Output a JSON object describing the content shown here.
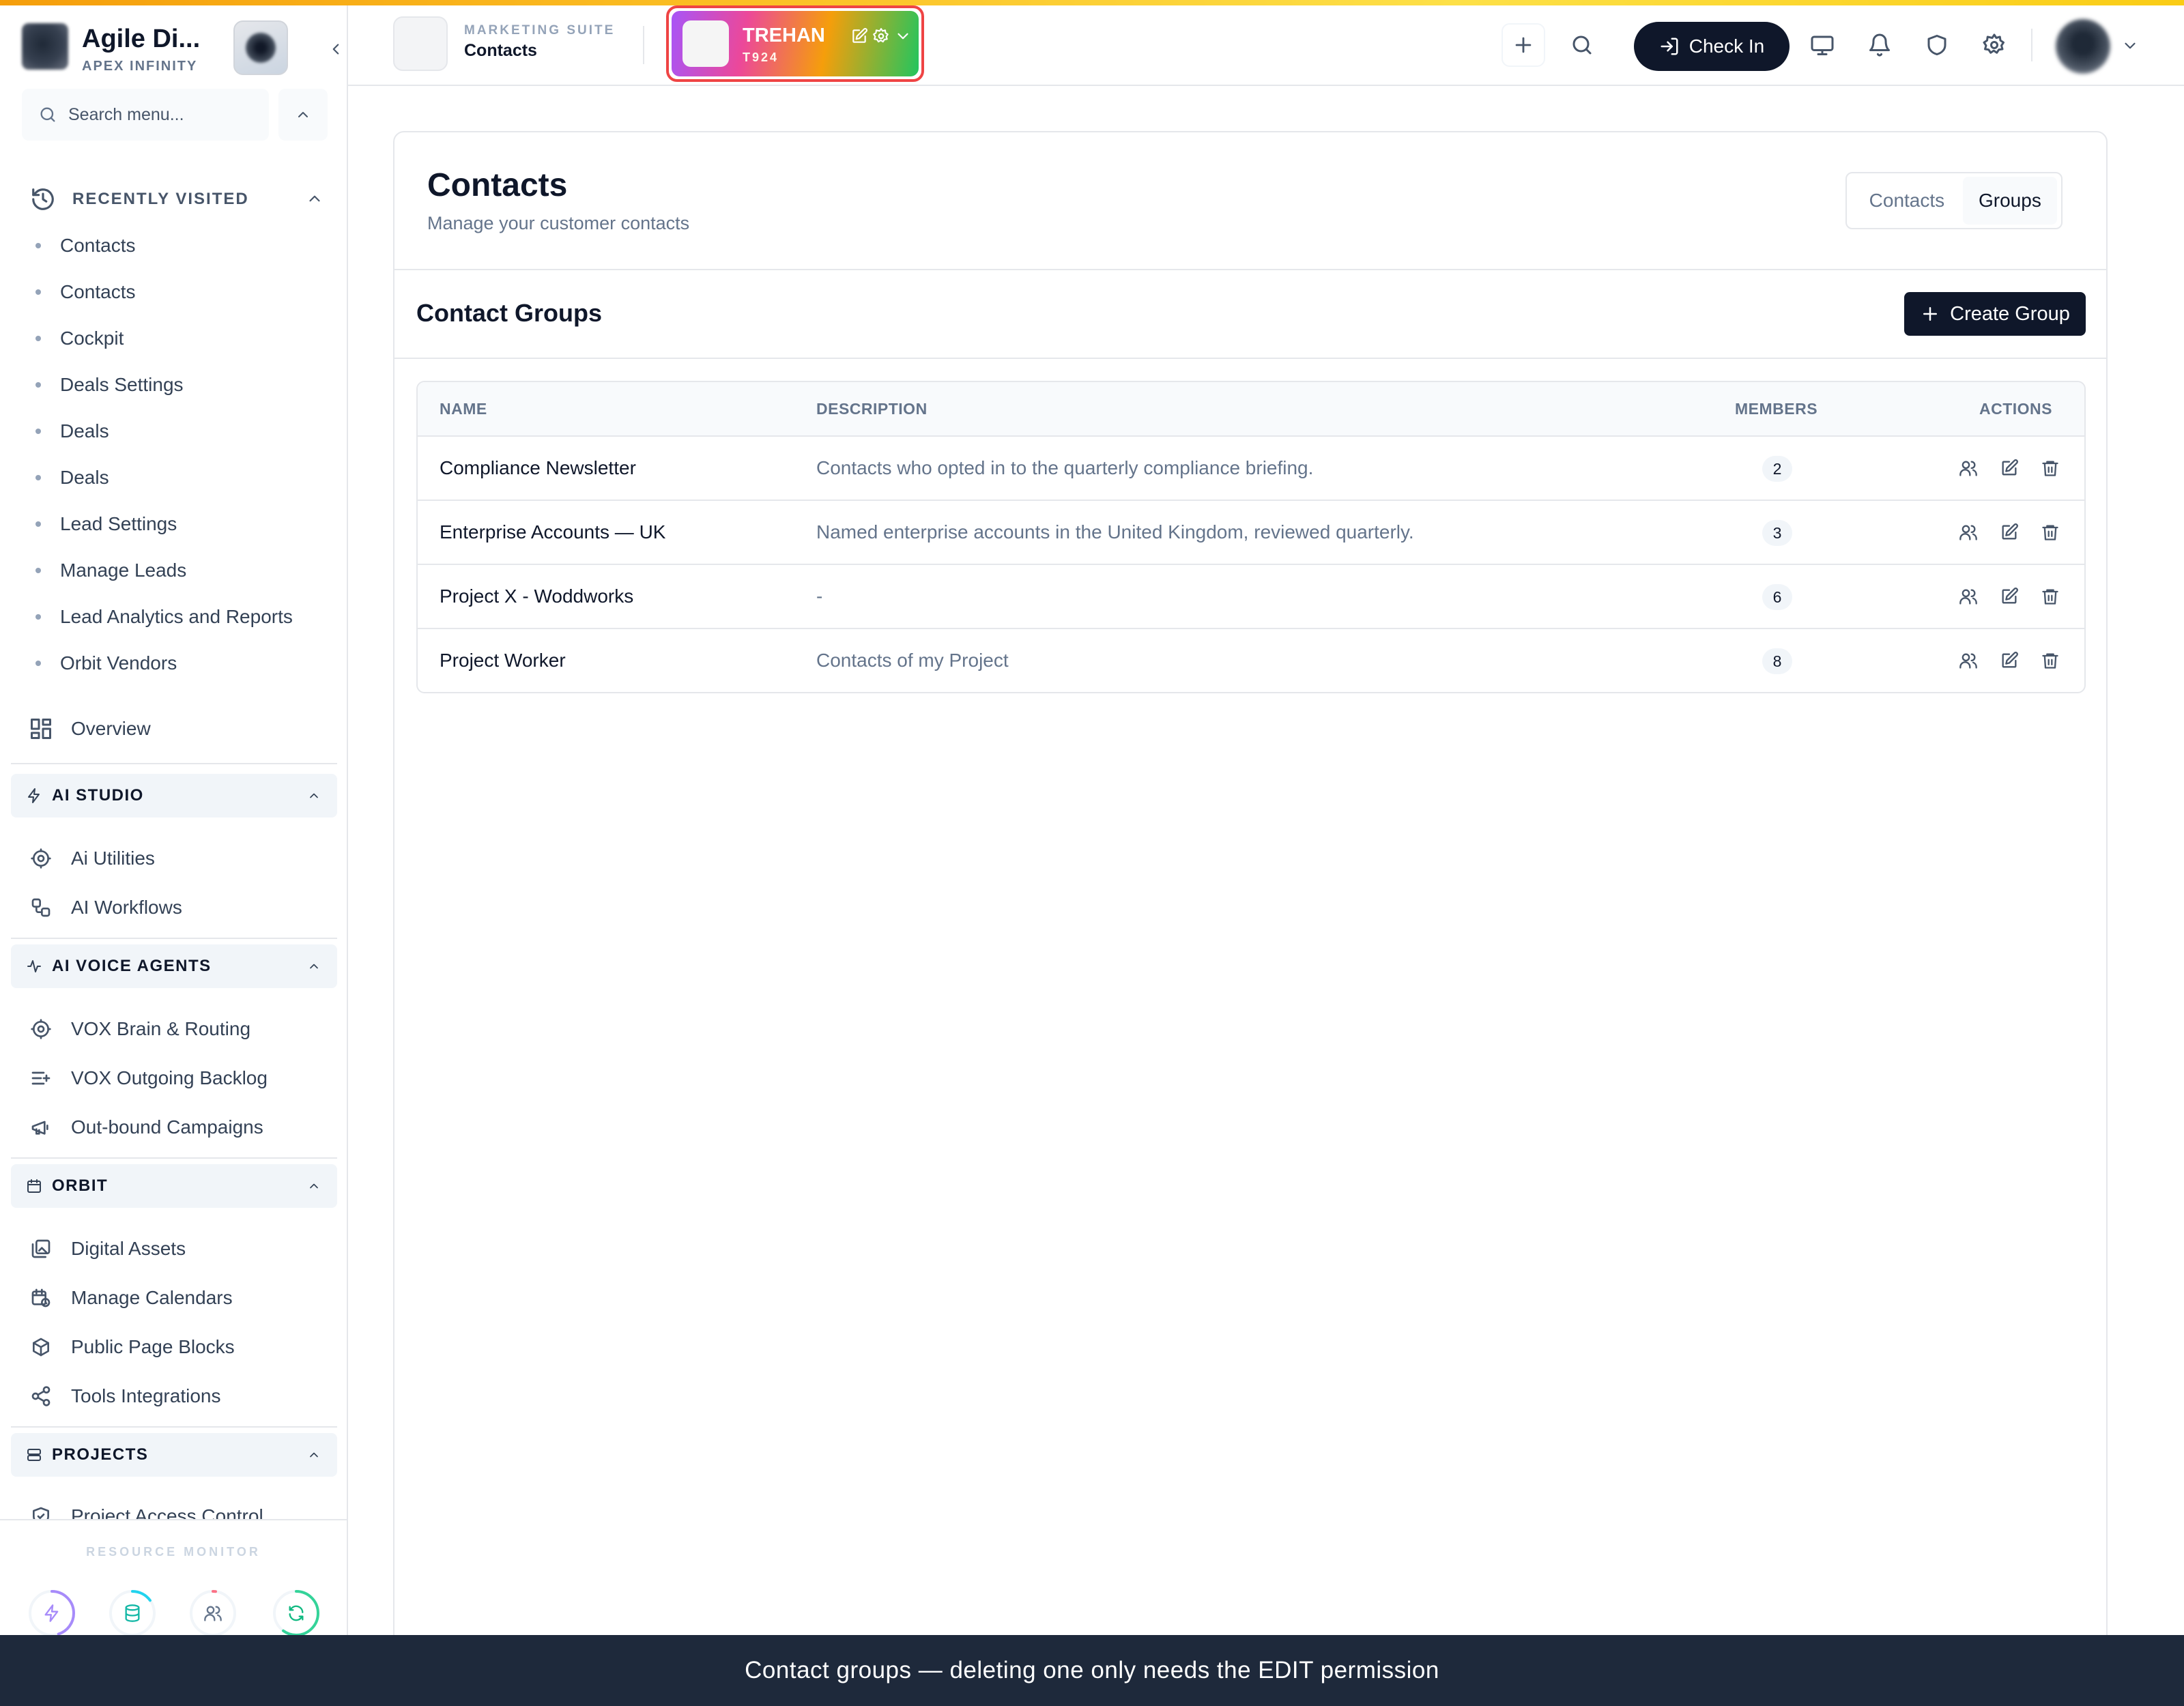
{
  "colors": {
    "accent_strip": "#fbbf24",
    "primary_dark": "#0f172a",
    "tenant_outline": "#ef4444",
    "tenant_gradient": [
      "#a855f7",
      "#ec4899",
      "#f59e0b",
      "#22c55e"
    ],
    "caption_bg": "#1e293b"
  },
  "sidebar": {
    "brand_name": "Agile Di...",
    "brand_sub": "APEX INFINITY",
    "collapse_icon": "chevron-left-icon",
    "search_placeholder": "Search menu...",
    "recent": {
      "label": "RECENTLY VISITED",
      "items": [
        "Contacts",
        "Contacts",
        "Cockpit",
        "Deals Settings",
        "Deals",
        "Deals",
        "Lead Settings",
        "Manage Leads",
        "Lead Analytics and Reports",
        "Orbit Vendors"
      ]
    },
    "overview": {
      "label": "Overview",
      "icon": "layout-dashboard-icon"
    },
    "sections": [
      {
        "title": "AI STUDIO",
        "icon": "zap-icon",
        "items": [
          {
            "label": "Ai Utilities",
            "icon": "cog-icon"
          },
          {
            "label": "AI Workflows",
            "icon": "workflow-icon"
          }
        ]
      },
      {
        "title": "AI VOICE AGENTS",
        "icon": "activity-icon",
        "items": [
          {
            "label": "VOX Brain & Routing",
            "icon": "cog-icon"
          },
          {
            "label": "VOX Outgoing Backlog",
            "icon": "list-plus-icon"
          },
          {
            "label": "Out-bound Campaigns",
            "icon": "megaphone-icon"
          }
        ]
      },
      {
        "title": "ORBIT",
        "icon": "calendar-icon",
        "items": [
          {
            "label": "Digital Assets",
            "icon": "images-icon"
          },
          {
            "label": "Manage Calendars",
            "icon": "calendar-clock-icon"
          },
          {
            "label": "Public Page Blocks",
            "icon": "box-icon"
          },
          {
            "label": "Tools Integrations",
            "icon": "share-icon"
          }
        ]
      },
      {
        "title": "PROJECTS",
        "icon": "server-icon",
        "items": [
          {
            "label": "Project Access Control",
            "icon": "shield-check-icon"
          }
        ]
      }
    ],
    "resource_monitor": {
      "label": "RESOURCE MONITOR",
      "gauges": [
        {
          "icon": "zap-icon",
          "level": 0.45,
          "color": "#a78bfa"
        },
        {
          "icon": "database-icon",
          "level": 0.15,
          "color": "#22d3ee"
        },
        {
          "icon": "users-icon",
          "level": 0.02,
          "color": "#fb7185"
        },
        {
          "icon": "refresh-icon",
          "level": 0.6,
          "color": "#34d399"
        }
      ]
    }
  },
  "topbar": {
    "suite_label": "MARKETING SUITE",
    "suite_page": "Contacts",
    "tenant": {
      "name": "TREHAN",
      "code": "T924"
    },
    "check_in_label": "Check In"
  },
  "main": {
    "title": "Contacts",
    "subtitle": "Manage your customer contacts",
    "tabs": [
      "Contacts",
      "Groups"
    ],
    "active_tab": "Groups",
    "groups_title": "Contact Groups",
    "create_label": "Create Group",
    "table": {
      "columns": [
        "NAME",
        "DESCRIPTION",
        "MEMBERS",
        "ACTIONS"
      ],
      "rows": [
        {
          "name": "Compliance Newsletter",
          "description": "Contacts who opted in to the quarterly compliance briefing.",
          "members": "2"
        },
        {
          "name": "Enterprise Accounts — UK",
          "description": "Named enterprise accounts in the United Kingdom, reviewed quarterly.",
          "members": "3"
        },
        {
          "name": "Project X - Woddworks",
          "description": "-",
          "members": "6"
        },
        {
          "name": "Project Worker",
          "description": "Contacts of my Project",
          "members": "8"
        }
      ]
    }
  },
  "caption": "Contact groups — deleting one only needs the EDIT permission"
}
